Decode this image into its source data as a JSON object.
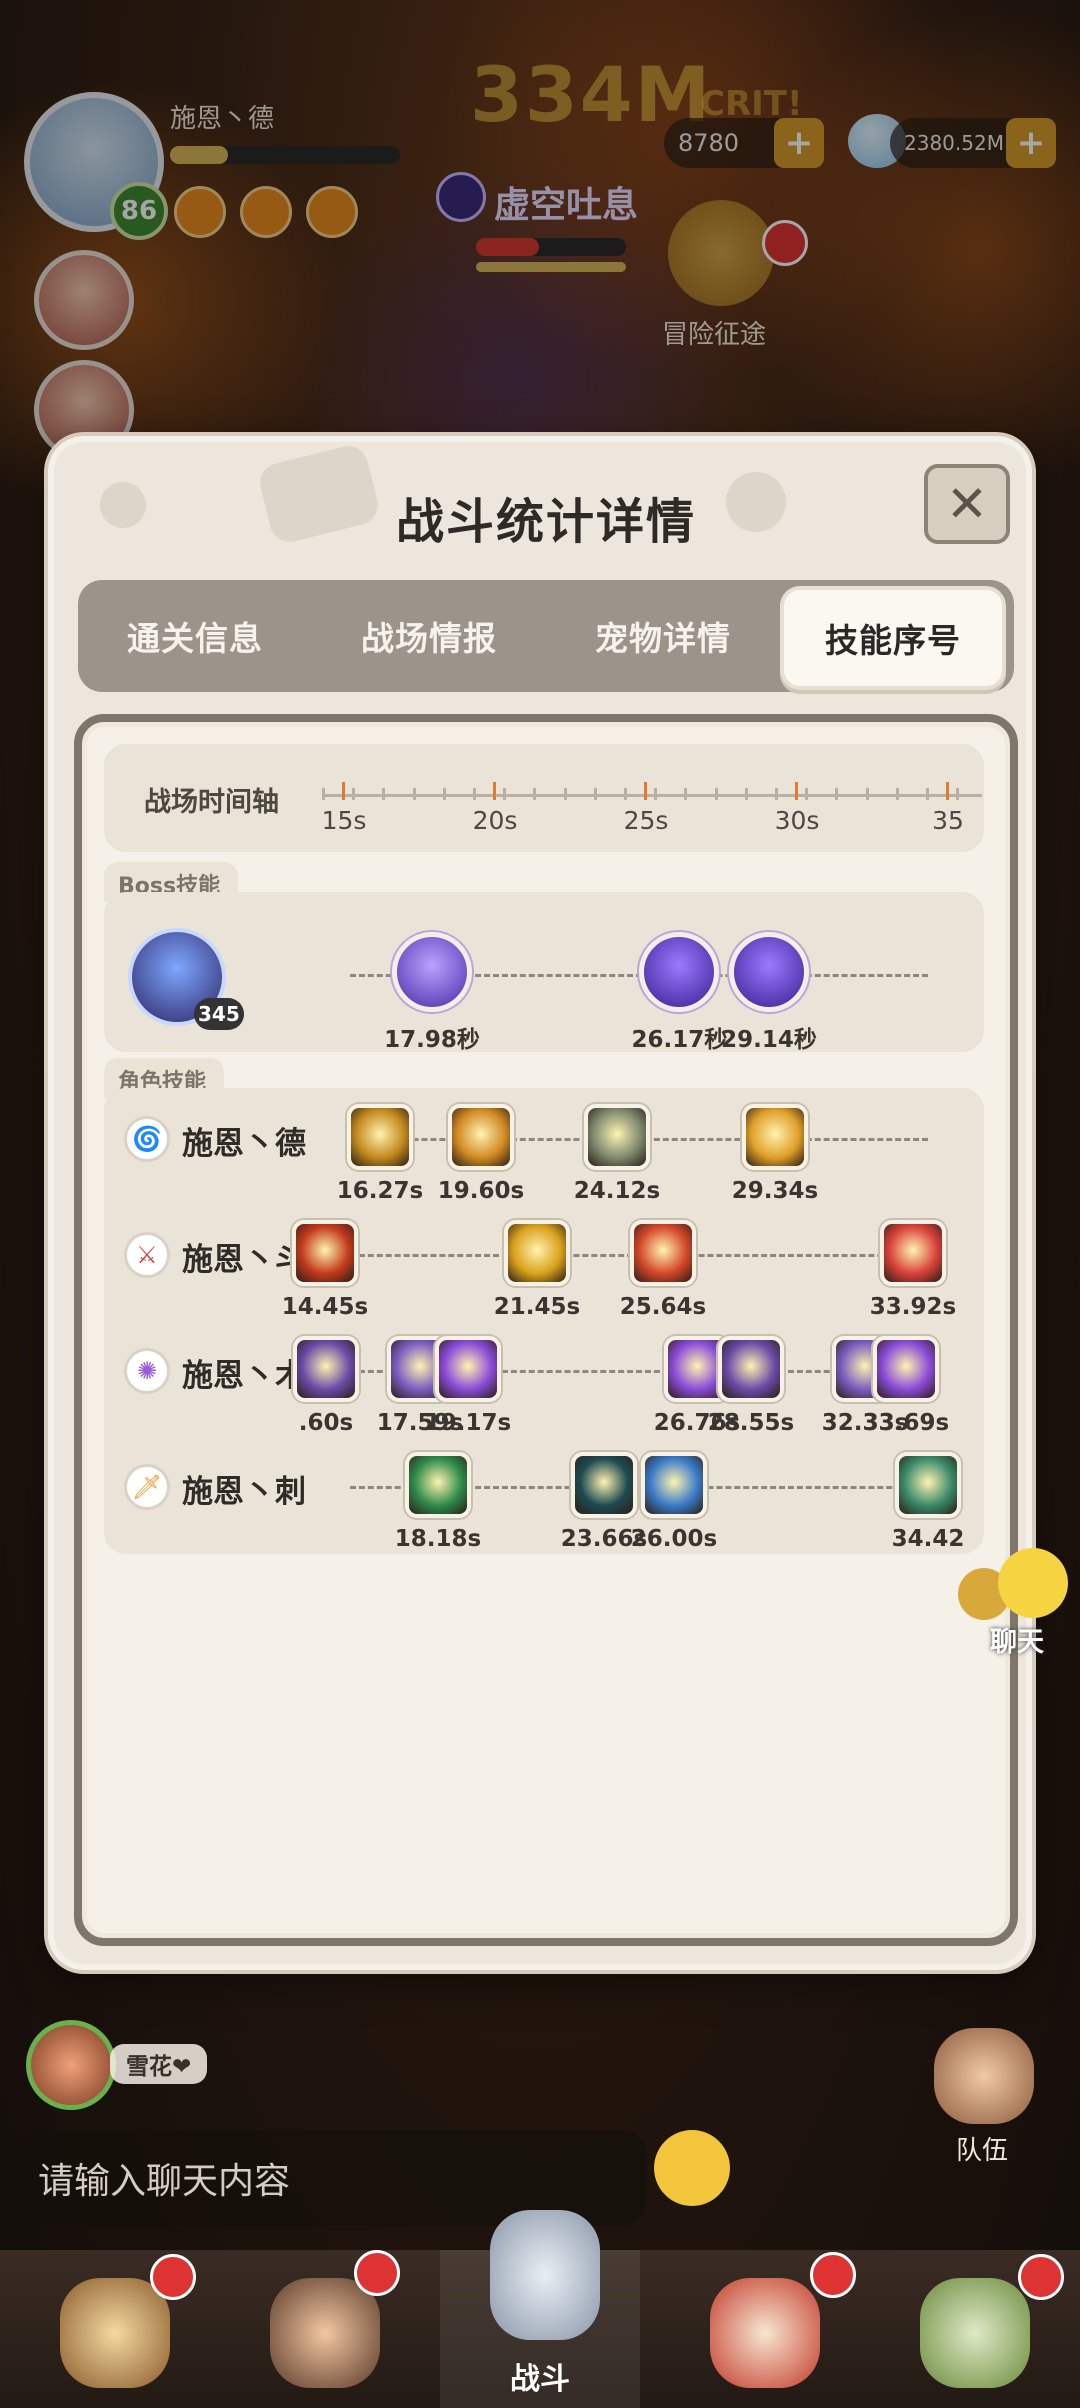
{
  "hud": {
    "player_name": "施恩丶德",
    "player_level": "86",
    "boss_name": "虚空吐息",
    "damage_popup": "334M",
    "crit_popup": "CRIT!",
    "currency_1": "8780",
    "currency_2": "2380.52M",
    "adventure_label": "冒险征途"
  },
  "modal": {
    "title": "战斗统计详情",
    "close_label": "✕",
    "tabs": [
      {
        "label": "通关信息",
        "active": false
      },
      {
        "label": "战场情报",
        "active": false
      },
      {
        "label": "宠物详情",
        "active": false
      },
      {
        "label": "技能序号",
        "active": true
      }
    ]
  },
  "timeline": {
    "label": "战场时间轴",
    "ticks": [
      "15s",
      "20s",
      "25s",
      "30s",
      "35"
    ]
  },
  "boss_section": {
    "label": "Boss技能",
    "count": "345",
    "skills": [
      {
        "time": "17.98秒",
        "icon": "void-orb-icon"
      },
      {
        "time": "26.17秒",
        "icon": "void-claw-icon"
      },
      {
        "time": "29.14秒",
        "icon": "void-claw-icon"
      }
    ]
  },
  "role_section": {
    "label": "角色技能",
    "rows": [
      {
        "name": "施恩丶德",
        "icon": "water-swirl-icon",
        "skills": [
          {
            "time": "16.27s",
            "color": "#c48a1e"
          },
          {
            "time": "19.60s",
            "color": "#d28a24"
          },
          {
            "time": "24.12s",
            "color": "#7f8a6e"
          },
          {
            "time": "29.34s",
            "color": "#e0a02a"
          }
        ]
      },
      {
        "name": "施恩丶斗",
        "icon": "crossed-swords-icon",
        "skills": [
          {
            "time": "14.45s",
            "color": "#c23a1c"
          },
          {
            "time": "21.45s",
            "color": "#d9a11c"
          },
          {
            "time": "25.64s",
            "color": "#d4472a"
          },
          {
            "time": "33.92s",
            "color": "#d8423a"
          }
        ]
      },
      {
        "name": "施恩丶术",
        "icon": "arcane-swirl-icon",
        "skills": [
          {
            "time": ".60s",
            "color": "#6a4aa8"
          },
          {
            "time": "17.59s",
            "color": "#7a5cc0"
          },
          {
            "time": "19.17s",
            "color": "#8a4ad8"
          },
          {
            "time": "26.76s",
            "color": "#8a4ad8"
          },
          {
            "time": "28.55s",
            "color": "#6a4aa8"
          },
          {
            "time": "32.33s",
            "color": "#7a5cc0"
          },
          {
            "time": "33.69s",
            "color": "#8a4ad8"
          }
        ]
      },
      {
        "name": "施恩丶刺",
        "icon": "dagger-icon",
        "skills": [
          {
            "time": "18.18s",
            "color": "#2e8a4a"
          },
          {
            "time": "23.66s",
            "color": "#1e4a52"
          },
          {
            "time": "26.00s",
            "color": "#3a7ac8"
          },
          {
            "time": "34.42",
            "color": "#3a8a6a"
          }
        ]
      }
    ]
  },
  "chat": {
    "side_label": "聊天",
    "player_chip": "雪花❤",
    "input_placeholder": "请输入聊天内容",
    "team_label": "队伍"
  },
  "bottom_nav": {
    "items": [
      {
        "label": "",
        "icon": "chieftain-icon"
      },
      {
        "label": "",
        "icon": "hero-icon"
      },
      {
        "label": "战斗",
        "icon": "battle-icon"
      },
      {
        "label": "",
        "icon": "pet-icon"
      },
      {
        "label": "",
        "icon": "tribe-icon"
      }
    ]
  }
}
